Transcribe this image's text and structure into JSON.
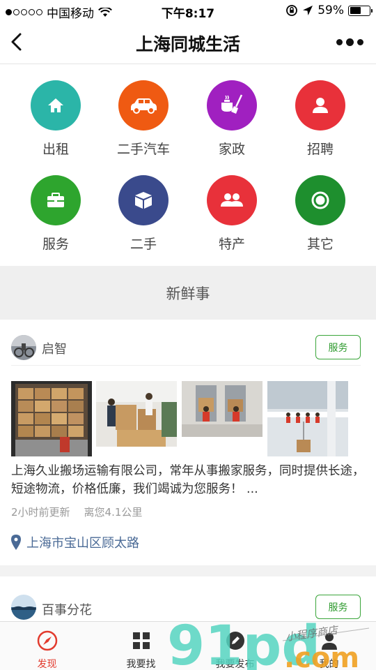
{
  "status_bar": {
    "carrier": "中国移动",
    "time": "下午8:17",
    "battery": "59%",
    "battery_level": 0.59
  },
  "nav": {
    "title": "上海同城生活"
  },
  "categories": [
    {
      "label": "出租",
      "icon": "house-icon",
      "color": "#2bb5a8"
    },
    {
      "label": "二手汽车",
      "icon": "car-icon",
      "color": "#ef5a12"
    },
    {
      "label": "家政",
      "icon": "housekeeping-icon",
      "color": "#a020c0"
    },
    {
      "label": "招聘",
      "icon": "person-icon",
      "color": "#e8313a"
    },
    {
      "label": "服务",
      "icon": "toolbox-icon",
      "color": "#2ea52e"
    },
    {
      "label": "二手",
      "icon": "box-icon",
      "color": "#3a4a8c"
    },
    {
      "label": "特产",
      "icon": "group-icon",
      "color": "#e8313a"
    },
    {
      "label": "其它",
      "icon": "circle-icon",
      "color": "#1e8f2e"
    }
  ],
  "section": {
    "title": "新鲜事"
  },
  "posts": [
    {
      "user": "启智",
      "tag": "服务",
      "text": "上海久业搬场运输有限公司，常年从事搬家服务，同时提供长途，短途物流，价格低廉，我们竭诚为您服务！ ...",
      "updated": "2小时前更新",
      "distance": "离您4.1公里",
      "location": "上海市宝山区顾太路"
    },
    {
      "user": "百事分花",
      "tag": "服务"
    }
  ],
  "tabs": [
    {
      "label": "发现",
      "icon": "compass-icon",
      "active": true
    },
    {
      "label": "我要找",
      "icon": "grid-icon",
      "active": false
    },
    {
      "label": "我要发布",
      "icon": "edit-icon",
      "active": false
    },
    {
      "label": "我的",
      "icon": "user-icon",
      "active": false
    }
  ],
  "watermark": {
    "brand": "91pd",
    "suffix": ".com",
    "slogan": "小程序商店"
  },
  "colors": {
    "accent": "#e23b2e",
    "tag_green": "#2e9a2e",
    "location_blue": "#4a6a96"
  }
}
